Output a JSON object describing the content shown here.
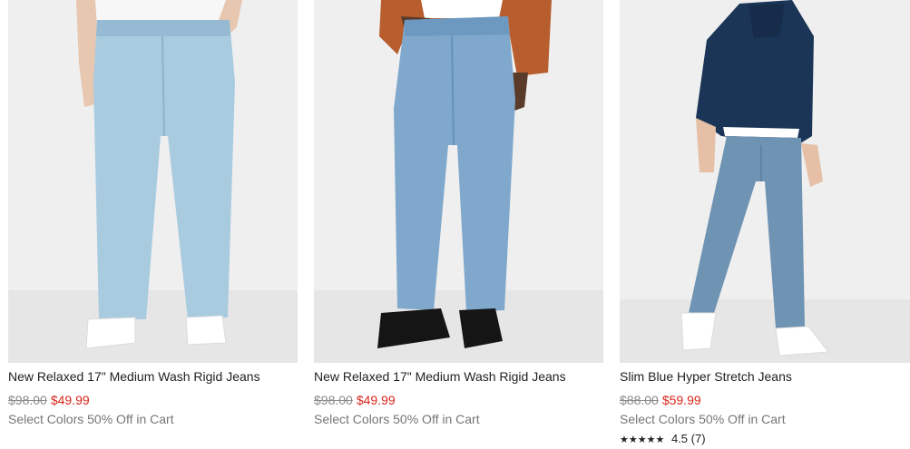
{
  "products": [
    {
      "image_alt": "new-relaxed-jeans-light-wash-photo",
      "title": "New Relaxed 17\" Medium Wash Rigid Jeans",
      "original_price": "$98.00",
      "sale_price": "$49.99",
      "promo": "Select Colors 50% Off in Cart"
    },
    {
      "image_alt": "new-relaxed-jeans-medium-wash-photo",
      "title": "New Relaxed 17\" Medium Wash Rigid Jeans",
      "original_price": "$98.00",
      "sale_price": "$49.99",
      "promo": "Select Colors 50% Off in Cart"
    },
    {
      "image_alt": "slim-blue-hyper-stretch-jeans-photo",
      "title": "Slim Blue Hyper Stretch Jeans",
      "original_price": "$88.00",
      "sale_price": "$59.99",
      "promo": "Select Colors 50% Off in Cart",
      "rating_stars": "★★★★★",
      "rating_value": "4.5",
      "rating_count": "(7)"
    }
  ],
  "colors": {
    "sale_red": "#d9261c",
    "strike_gray": "#8a8a8a",
    "promo_gray": "#767676",
    "title_dark": "#222222",
    "image_bg": "#f0f0f0"
  }
}
